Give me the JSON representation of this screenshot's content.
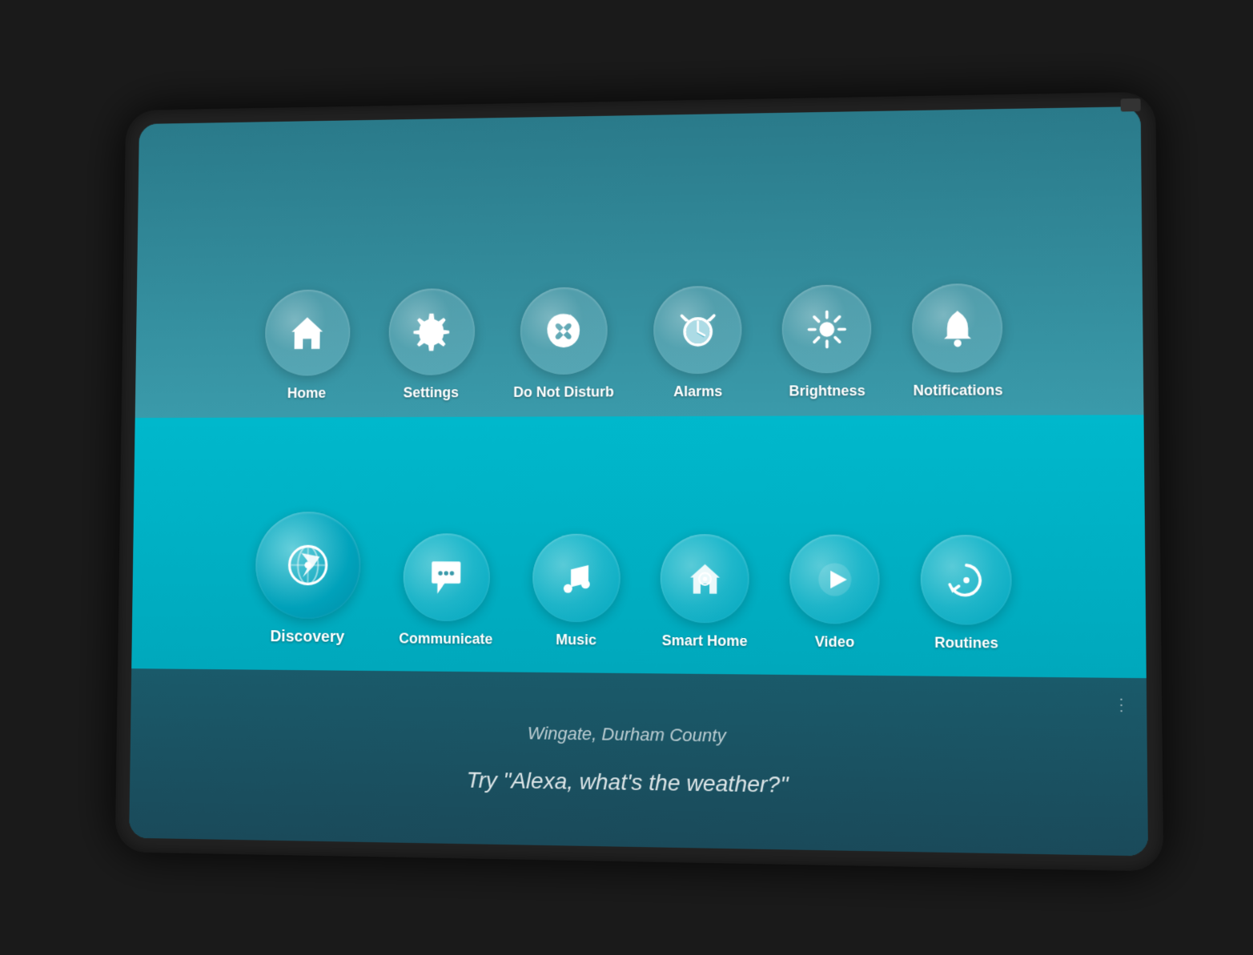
{
  "device": {
    "camera_alt": "front camera"
  },
  "top_row": {
    "items": [
      {
        "id": "home",
        "label": "Home",
        "icon": "home"
      },
      {
        "id": "settings",
        "label": "Settings",
        "icon": "settings"
      },
      {
        "id": "do-not-disturb",
        "label": "Do Not Disturb",
        "icon": "dnd"
      },
      {
        "id": "alarms",
        "label": "Alarms",
        "icon": "alarm"
      },
      {
        "id": "brightness",
        "label": "Brightness",
        "icon": "brightness"
      },
      {
        "id": "notifications",
        "label": "Notifications",
        "icon": "notifications"
      }
    ]
  },
  "bottom_row": {
    "items": [
      {
        "id": "discovery",
        "label": "Discovery",
        "icon": "discovery",
        "size": "large"
      },
      {
        "id": "communicate",
        "label": "Communicate",
        "icon": "communicate"
      },
      {
        "id": "music",
        "label": "Music",
        "icon": "music"
      },
      {
        "id": "smart-home",
        "label": "Smart Home",
        "icon": "smarthome"
      },
      {
        "id": "video",
        "label": "Video",
        "icon": "video"
      },
      {
        "id": "routines",
        "label": "Routines",
        "icon": "routines"
      }
    ]
  },
  "footer": {
    "location": "Wingate, Durham County",
    "suggestion": "Try \"Alexa, what's the weather?\""
  }
}
